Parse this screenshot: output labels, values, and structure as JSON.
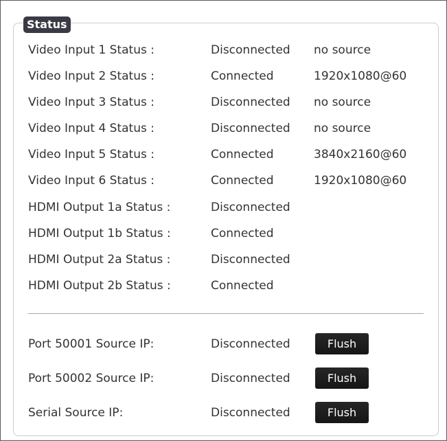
{
  "section": {
    "legend": "Status"
  },
  "status_rows": [
    {
      "label": "Video Input 1 Status :",
      "state": "Disconnected",
      "resolution": "no source"
    },
    {
      "label": "Video Input 2 Status :",
      "state": "Connected",
      "resolution": "1920x1080@60"
    },
    {
      "label": "Video Input 3 Status :",
      "state": "Disconnected",
      "resolution": "no source"
    },
    {
      "label": "Video Input 4 Status :",
      "state": "Disconnected",
      "resolution": "no source"
    },
    {
      "label": "Video Input 5 Status :",
      "state": "Connected",
      "resolution": "3840x2160@60"
    },
    {
      "label": "Video Input 6 Status :",
      "state": "Connected",
      "resolution": "1920x1080@60"
    },
    {
      "label": "HDMI Output 1a Status :",
      "state": "Disconnected",
      "resolution": ""
    },
    {
      "label": "HDMI Output 1b Status :",
      "state": "Connected",
      "resolution": ""
    },
    {
      "label": "HDMI Output 2a Status :",
      "state": "Disconnected",
      "resolution": ""
    },
    {
      "label": "HDMI Output 2b Status :",
      "state": "Connected",
      "resolution": ""
    }
  ],
  "source_ip_rows": [
    {
      "label": "Port 50001 Source IP:",
      "state": "Disconnected",
      "button": "Flush"
    },
    {
      "label": "Port 50002 Source IP:",
      "state": "Disconnected",
      "button": "Flush"
    },
    {
      "label": "Serial Source IP:",
      "state": "Disconnected",
      "button": "Flush"
    }
  ],
  "colors": {
    "legend_bg": "#3a3a44",
    "button_bg": "#1e1e1e",
    "text": "#333333"
  }
}
